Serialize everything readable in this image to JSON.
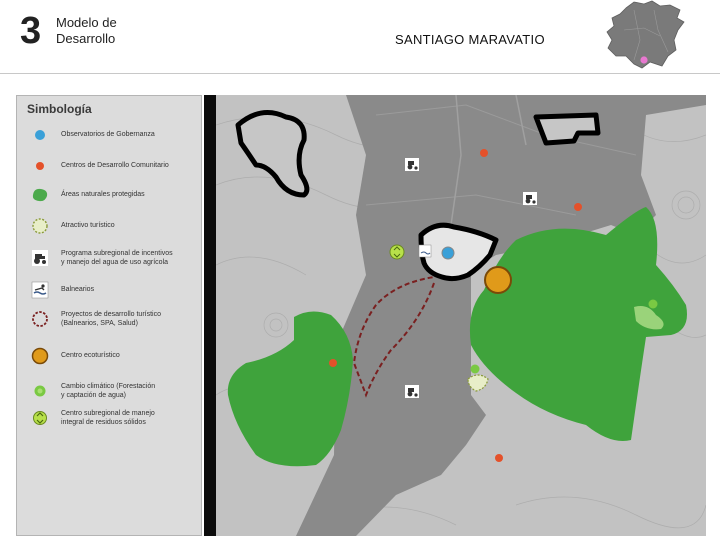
{
  "header": {
    "number": "3",
    "topic_line1": "Modelo de",
    "topic_line2": "Desarrollo",
    "municipality": "SANTIAGO MARAVATIO"
  },
  "legend": {
    "title": "Simbología",
    "items": [
      {
        "icon": "blue-dot-icon",
        "color": "#3aa0d8",
        "lines": [
          "Observatorios de Gobernanza"
        ]
      },
      {
        "icon": "red-dot-icon",
        "color": "#e4512a",
        "lines": [
          "Centros de Desarrollo Comunitario"
        ]
      },
      {
        "icon": "green-area-icon",
        "color": "#4caa4c",
        "lines": [
          "Áreas naturales protegidas"
        ]
      },
      {
        "icon": "dashed-circle-icon",
        "color": "#c9d98a",
        "lines": [
          "Atractivo turístico"
        ]
      },
      {
        "icon": "tractor-icon",
        "color": "#333333",
        "lines": [
          "Programa subregional de incentivos",
          "y manejo del agua de uso agrícola"
        ]
      },
      {
        "icon": "swimmer-icon",
        "color": "#3a5a8a",
        "lines": [
          "Balnearios"
        ]
      },
      {
        "icon": "dashed-ring-icon",
        "color": "#7a2020",
        "lines": [
          "Proyectos de desarrollo turístico",
          "(Balnearios, SPA, Salud)"
        ]
      },
      {
        "icon": "orange-circle-icon",
        "color": "#e09a1a",
        "lines": [
          "Centro ecoturístico"
        ]
      },
      {
        "icon": "sprout-icon",
        "color": "#7ac943",
        "lines": [
          "Cambio climático (Forestación",
          "y captación de agua)"
        ]
      },
      {
        "icon": "recycle-icon",
        "color": "#b8e04a",
        "lines": [
          "Centro subregional de manejo",
          "integral de residuos sólidos"
        ]
      }
    ]
  },
  "map": {
    "colors": {
      "background": "#c2c2c2",
      "municipality": "#8a8a8a",
      "protected_area": "#3fa33c",
      "urban": "#e6e6e6",
      "boundary": "#000000",
      "community_center": "#e4512a",
      "project_route": "#7a2020"
    }
  }
}
